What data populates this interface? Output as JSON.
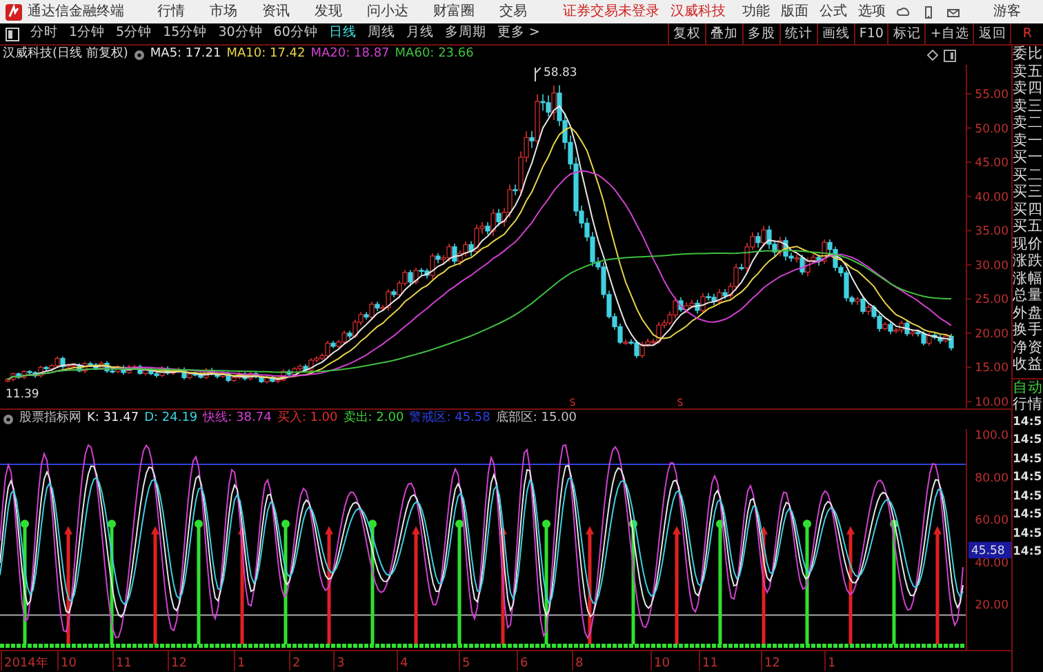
{
  "app": {
    "title": "通达信金融终端",
    "menu": [
      "行情",
      "市场",
      "资讯",
      "发现",
      "问小达",
      "财富圈",
      "交易"
    ],
    "notice": [
      "证券交易未登录",
      "汉威科技"
    ],
    "right_menu": [
      "功能",
      "版面",
      "公式",
      "选项"
    ],
    "user": "游客"
  },
  "toolbar": {
    "periods": [
      {
        "label": "分时",
        "selected": false
      },
      {
        "label": "1分钟",
        "selected": false
      },
      {
        "label": "5分钟",
        "selected": false
      },
      {
        "label": "15分钟",
        "selected": false
      },
      {
        "label": "30分钟",
        "selected": false
      },
      {
        "label": "60分钟",
        "selected": false
      },
      {
        "label": "日线",
        "selected": true
      },
      {
        "label": "周线",
        "selected": false
      },
      {
        "label": "月线",
        "selected": false
      },
      {
        "label": "多周期",
        "selected": false
      },
      {
        "label": "更多 >",
        "selected": false
      }
    ],
    "buttons": [
      "复权",
      "叠加",
      "多股",
      "统计",
      "画线",
      "F10",
      "标记",
      "+自选",
      "返回"
    ],
    "corner": "R"
  },
  "price_chart": {
    "title": "汉威科技(日线 前复权)",
    "legend": [
      {
        "text": "MA5: 17.21",
        "color": "#e8e8e8"
      },
      {
        "text": "MA10: 17.42",
        "color": "#e8d44a"
      },
      {
        "text": "MA20: 18.87",
        "color": "#d040d0"
      },
      {
        "text": "MA60: 23.66",
        "color": "#40c040"
      }
    ],
    "high_label": "58.83",
    "low_label": "11.39",
    "signals": [
      "S",
      "S"
    ],
    "yticks": [
      "55.00",
      "50.00",
      "45.00",
      "40.00",
      "35.00",
      "30.00",
      "25.00",
      "20.00",
      "15.00",
      "10.00"
    ]
  },
  "indicator": {
    "legend": [
      {
        "text": "股票指标网",
        "color": "#c0c0c0"
      },
      {
        "text": "K: 31.47",
        "color": "#e8e8e8"
      },
      {
        "text": "D: 24.19",
        "color": "#40d0e0"
      },
      {
        "text": "快线: 38.74",
        "color": "#d040d0"
      },
      {
        "text": "买入: 1.00",
        "color": "#e03030"
      },
      {
        "text": "卖出: 2.00",
        "color": "#40d040"
      },
      {
        "text": "警戒区: 45.58",
        "color": "#3040e0"
      },
      {
        "text": "底部区: 15.00",
        "color": "#c0c0c0"
      }
    ],
    "yticks": [
      "100.0",
      "80.00",
      "60.00",
      "40.00",
      "20.00"
    ],
    "current_value": "45.58"
  },
  "date_axis": [
    "2014年",
    "10",
    "11",
    "12",
    "1",
    "2",
    "3",
    "4",
    "5",
    "6",
    "8",
    "10",
    "11",
    "12",
    "1"
  ],
  "quote_panel": [
    "委比",
    "卖五",
    "卖四",
    "卖三",
    "卖二",
    "卖一",
    "买一",
    "买二",
    "买三",
    "买四",
    "买五",
    "现价",
    "涨跌",
    "涨幅",
    "总量",
    "外盘",
    "换手",
    "净资",
    "收益"
  ],
  "tick_panel": {
    "title": [
      "自动",
      "行情"
    ],
    "times": [
      "14:5",
      "14:5",
      "14:5",
      "14:5",
      "14:5",
      "14:5",
      "14:5",
      "14:5"
    ]
  }
}
